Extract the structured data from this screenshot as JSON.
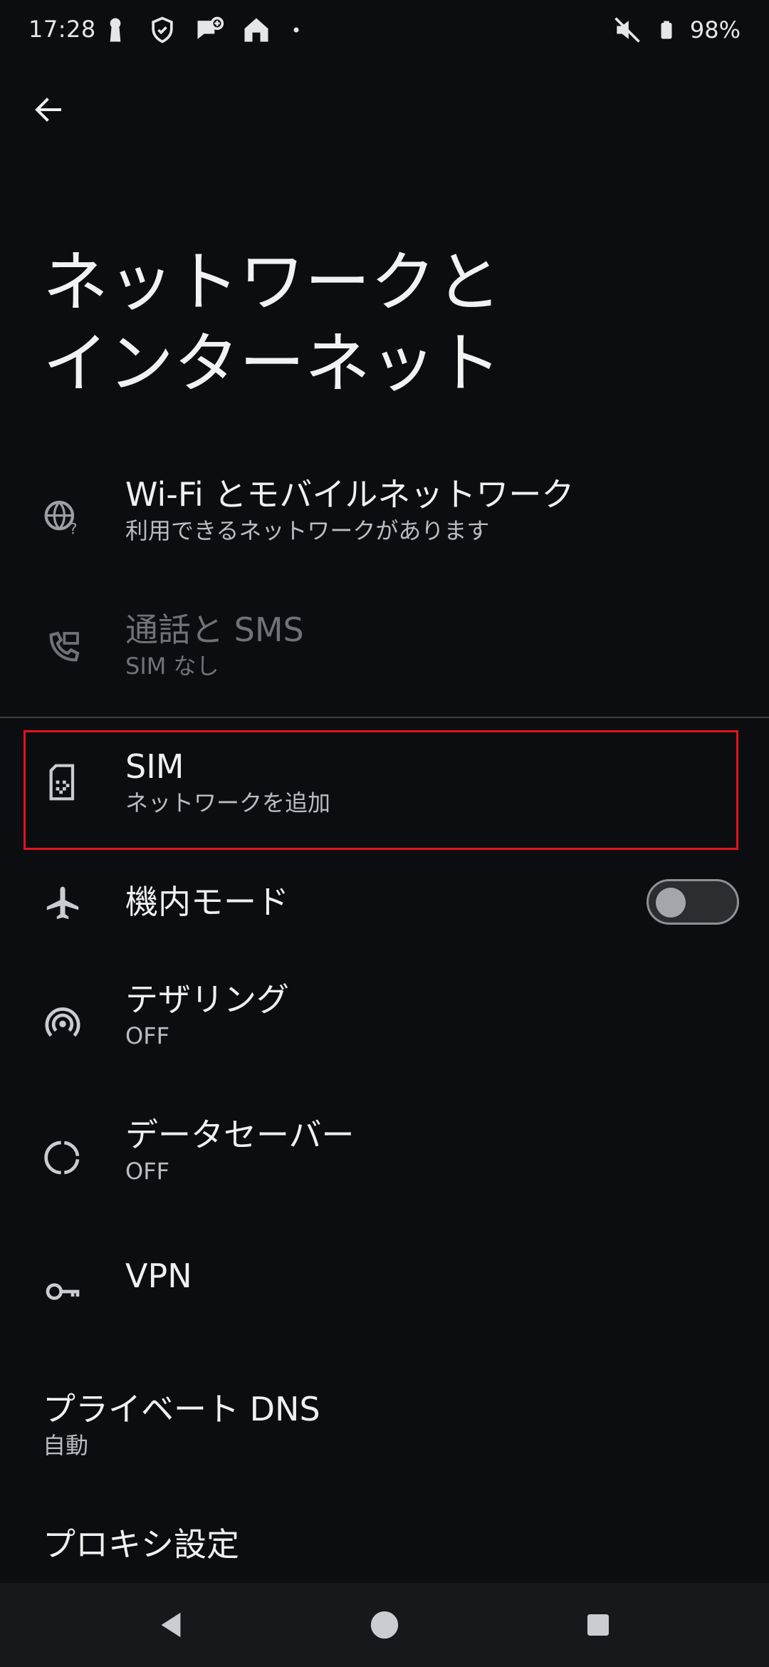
{
  "status_bar": {
    "time": "17:28",
    "battery_percent": "98%",
    "icons_left": [
      "keyhole-icon",
      "shield-icon",
      "chat-plus-icon",
      "home-icon",
      "dot-icon"
    ],
    "icons_right": [
      "mute-icon",
      "battery-icon"
    ]
  },
  "header": {
    "back_icon": "arrow-left-icon",
    "title": "ネットワークと\nインターネット"
  },
  "items": [
    {
      "icon": "globe-question-icon",
      "title": "Wi-Fi とモバイルネットワーク",
      "subtitle": "利用できるネットワークがあります",
      "enabled": true
    },
    {
      "icon": "phone-message-icon",
      "title": "通話と SMS",
      "subtitle": "SIM なし",
      "enabled": false
    },
    {
      "icon": "sim-card-icon",
      "title": "SIM",
      "subtitle": "ネットワークを追加",
      "enabled": true,
      "highlighted": true
    },
    {
      "icon": "airplane-icon",
      "title": "機内モード",
      "toggle": false
    },
    {
      "icon": "hotspot-icon",
      "title": "テザリング",
      "subtitle": "OFF"
    },
    {
      "icon": "data-saver-icon",
      "title": "データセーバー",
      "subtitle": "OFF"
    },
    {
      "icon": "key-icon",
      "title": "VPN"
    },
    {
      "title": "プライベート DNS",
      "subtitle": "自動"
    },
    {
      "title": "プロキシ設定"
    }
  ],
  "colors": {
    "background": "#0c0d10",
    "highlight": "#e0141e",
    "text_primary": "#f0f0f2",
    "text_secondary": "#b9bcc2",
    "text_disabled": "#6f7278"
  },
  "nav_bar": {
    "buttons": [
      "back-triangle-icon",
      "home-circle-icon",
      "recents-square-icon"
    ]
  }
}
